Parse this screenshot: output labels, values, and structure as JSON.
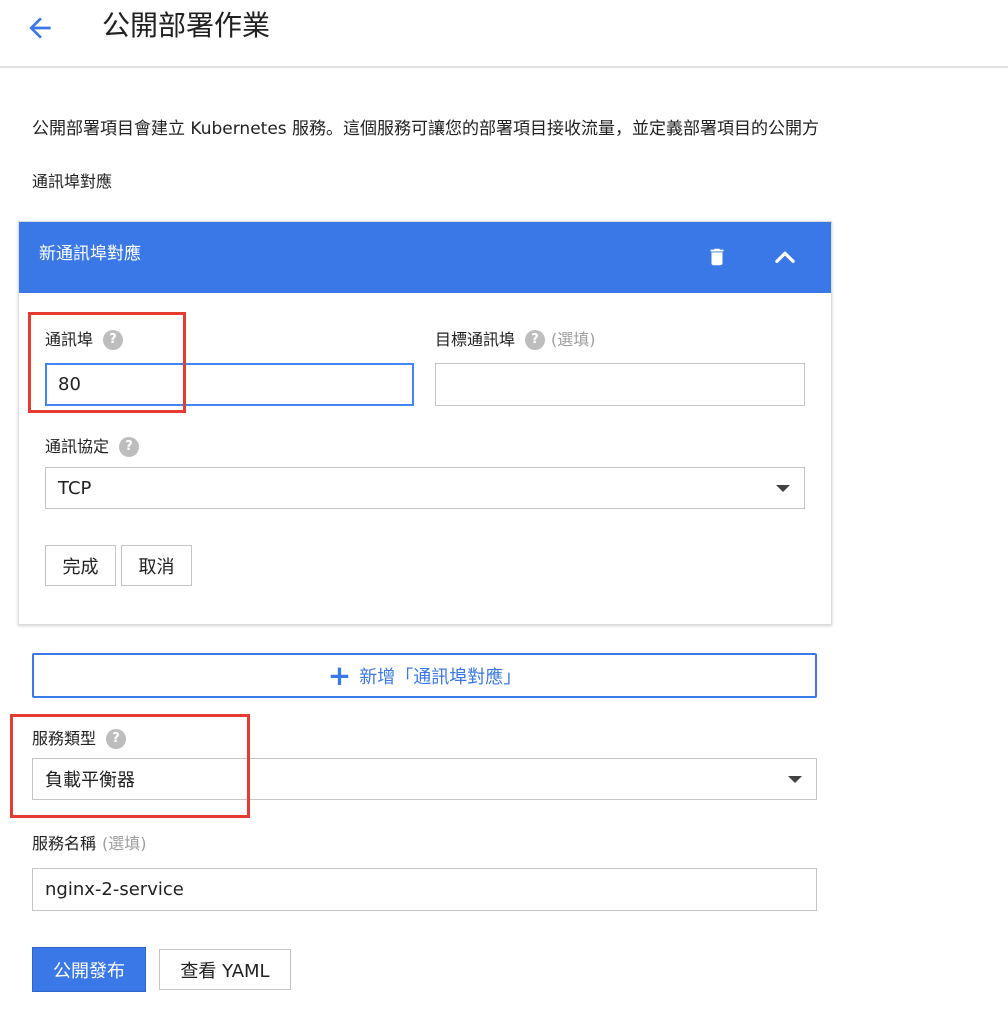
{
  "header": {
    "title": "公開部署作業",
    "back_icon": "arrow-left-icon"
  },
  "intro": "公開部署項目會建立 Kubernetes 服務。這個服務可讓您的部署項目接收流量，並定義部署項目的公開方",
  "port_mapping_section": {
    "label": "通訊埠對應",
    "card": {
      "title": "新通訊埠對應",
      "port": {
        "label": "通訊埠",
        "value": "80"
      },
      "target_port": {
        "label": "目標通訊埠",
        "optional": "(選填)",
        "value": ""
      },
      "protocol": {
        "label": "通訊協定",
        "value": "TCP"
      },
      "done_label": "完成",
      "cancel_label": "取消"
    },
    "add_label": "新增「通訊埠對應」"
  },
  "service_type": {
    "label": "服務類型",
    "value": "負載平衡器"
  },
  "service_name": {
    "label": "服務名稱",
    "optional": "(選填)",
    "value": "nginx-2-service"
  },
  "actions": {
    "publish_label": "公開發布",
    "yaml_label": "查看 YAML"
  },
  "help_glyph": "?",
  "colors": {
    "accent": "#3b78e7",
    "highlight": "#e53b30",
    "help": "#bdbdbd"
  }
}
